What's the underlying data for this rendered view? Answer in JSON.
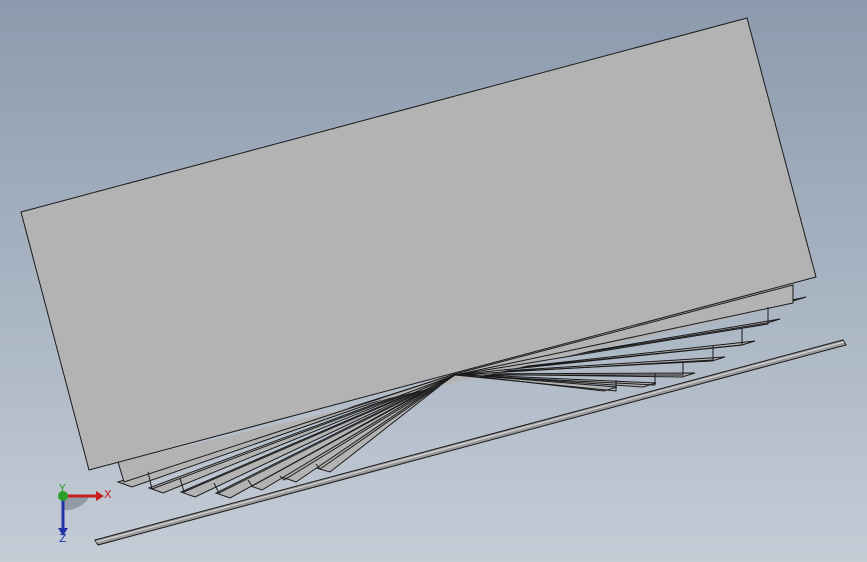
{
  "view": {
    "background_top": "#8b9bad",
    "background_bottom": "#c4ccd6",
    "model_face_color": "#b3b3b3",
    "model_edge_color": "#1a1a1a"
  },
  "triad": {
    "x_label": "X",
    "y_label": "Y",
    "z_label": "Z",
    "x_color": "#c8201c",
    "y_color": "#2aa02a",
    "z_color": "#2233aa"
  }
}
